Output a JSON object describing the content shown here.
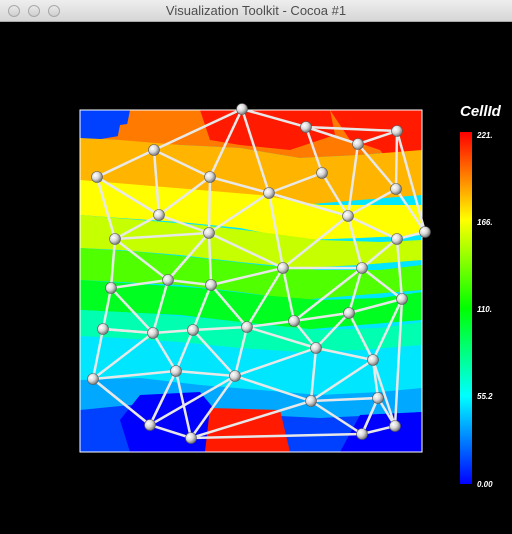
{
  "window": {
    "title": "Visualization Toolkit - Cocoa #1"
  },
  "scalar_bar": {
    "title": "CellId",
    "labels": [
      "221.",
      "166.",
      "110.",
      "55.2",
      "0.00"
    ],
    "range": [
      0,
      221
    ]
  },
  "colors": {
    "background": "#000000",
    "titlebar": "#e2e2e2",
    "mesh_edge": "#e8e8e8",
    "text": "#ffffff"
  },
  "mesh": {
    "band_colors_top_to_bottom": [
      "#ff1a00",
      "#ff7a00",
      "#ffb400",
      "#ffff00",
      "#c6ff00",
      "#50ff00",
      "#00ff20",
      "#00ffb0",
      "#00e6ff",
      "#00a8ff",
      "#0040ff"
    ]
  }
}
